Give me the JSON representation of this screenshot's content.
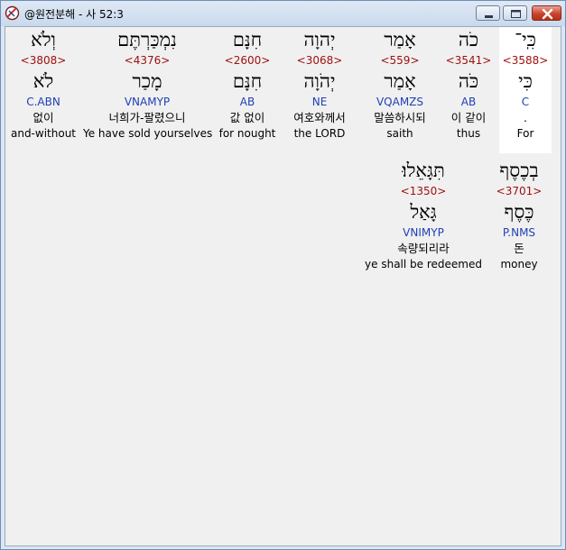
{
  "window": {
    "title": "@원전분해 - 사 52:3"
  },
  "words": [
    {
      "hebrew": "כִּֽי־",
      "strong": "<3588>",
      "lemma": "כִּי",
      "morph": "C",
      "korean": ".",
      "english": "For",
      "highlighted": true
    },
    {
      "hebrew": "כֹה",
      "strong": "<3541>",
      "lemma": "כֹּה",
      "morph": "AB",
      "korean": "이 같이",
      "english": "thus"
    },
    {
      "hebrew": "אָמַר",
      "strong": "<559>",
      "lemma": "אָמַר",
      "morph": "VQAMZS",
      "korean": "말씀하시되",
      "english": "saith"
    },
    {
      "hebrew": "יְהוָה",
      "strong": "<3068>",
      "lemma": "יְהֹוָה",
      "morph": "NE",
      "korean": "여호와께서",
      "english": "the LORD"
    },
    {
      "hebrew": "חִנָּם",
      "strong": "<2600>",
      "lemma": "חִנָּם",
      "morph": "AB",
      "korean": "값 없이",
      "english": "for nought"
    },
    {
      "hebrew": "נִמְכַּרְתֶּם",
      "strong": "<4376>",
      "lemma": "מָכַר",
      "morph": "VNAMYP",
      "korean": "너희가-팔렸으니",
      "english": "Ye have sold yourselves"
    },
    {
      "hebrew": "וְלֹא",
      "strong": "<3808>",
      "lemma": "לֹא",
      "morph": "C.ABN",
      "korean": "없이",
      "english": "and-without"
    },
    {
      "hebrew": "בְכֶסֶף",
      "strong": "<3701>",
      "lemma": "כֶּסֶף",
      "morph": "P.NMS",
      "korean": "돈",
      "english": "money"
    },
    {
      "hebrew": "תִּגָּאֵלוּ׃",
      "strong": "<1350>",
      "lemma": "גָּאַל",
      "morph": "VNIMYP",
      "korean": "속량되리라",
      "english": "ye shall be redeemed"
    }
  ]
}
